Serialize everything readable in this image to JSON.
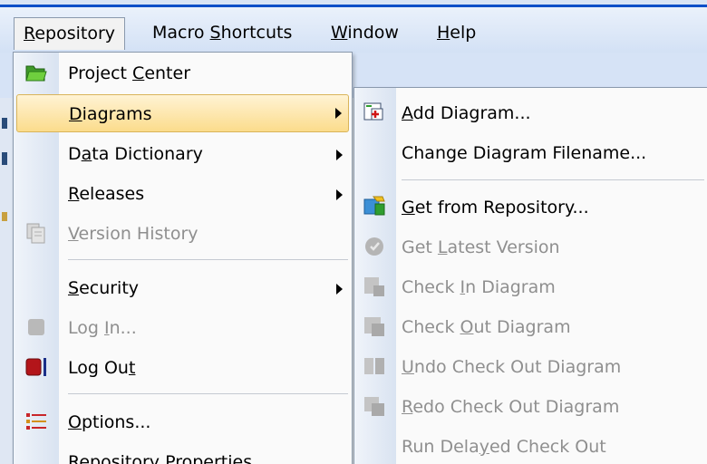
{
  "menubar": {
    "repository": {
      "pre": "",
      "acc": "R",
      "post": "epository"
    },
    "macro_shortcuts": {
      "pre": "Macro ",
      "acc": "S",
      "post": "hortcuts"
    },
    "window": {
      "pre": "",
      "acc": "W",
      "post": "indow"
    },
    "help": {
      "pre": "",
      "acc": "H",
      "post": "elp"
    }
  },
  "repository_menu": {
    "project_center": {
      "pre": "Project ",
      "acc": "C",
      "post": "enter",
      "icon": "folder-icon"
    },
    "diagrams": {
      "pre": "",
      "acc": "D",
      "post": "iagrams"
    },
    "data_dictionary": {
      "pre": "D",
      "acc": "a",
      "post": "ta Dictionary"
    },
    "releases": {
      "pre": "",
      "acc": "R",
      "post": "eleases"
    },
    "version_history": {
      "pre": "",
      "acc": "V",
      "post": "ersion History",
      "icon": "version-history-icon"
    },
    "security": {
      "pre": "",
      "acc": "S",
      "post": "ecurity"
    },
    "log_in": {
      "pre": "Log ",
      "acc": "I",
      "post": "n...",
      "icon": "log-in-icon"
    },
    "log_out": {
      "pre": "Log Ou",
      "acc": "t",
      "post": "",
      "icon": "log-out-icon"
    },
    "options": {
      "pre": "",
      "acc": "O",
      "post": "ptions...",
      "icon": "options-icon"
    },
    "repository_properties": {
      "pre": "Repository Properties...",
      "acc": "",
      "post": ""
    }
  },
  "diagrams_submenu": {
    "add_diagram": {
      "pre": "",
      "acc": "A",
      "post": "dd Diagram...",
      "icon": "add-diagram-icon"
    },
    "change_filename": {
      "pre": "Change Diagram Filename...",
      "acc": "",
      "post": ""
    },
    "get_from_repository": {
      "pre": "",
      "acc": "G",
      "post": "et from Repository...",
      "icon": "get-from-repository-icon"
    },
    "get_latest_version": {
      "pre": "Get ",
      "acc": "L",
      "post": "atest Version",
      "icon": "get-latest-icon"
    },
    "check_in": {
      "pre": "Check ",
      "acc": "I",
      "post": "n Diagram",
      "icon": "check-in-icon"
    },
    "check_out": {
      "pre": "Check ",
      "acc": "O",
      "post": "ut Diagram",
      "icon": "check-out-icon"
    },
    "undo_check_out": {
      "pre": "",
      "acc": "U",
      "post": "ndo Check Out Diagram",
      "icon": "undo-check-out-icon"
    },
    "redo_check_out": {
      "pre": "",
      "acc": "R",
      "post": "edo Check Out Diagram",
      "icon": "redo-check-out-icon"
    },
    "run_delayed": {
      "pre": "Run Dela",
      "acc": "y",
      "post": "ed Check Out"
    }
  },
  "colors": {
    "highlight": "#fbdc8c",
    "disabled_text": "#8f8f8f",
    "menubar": "#d3e1f5"
  }
}
